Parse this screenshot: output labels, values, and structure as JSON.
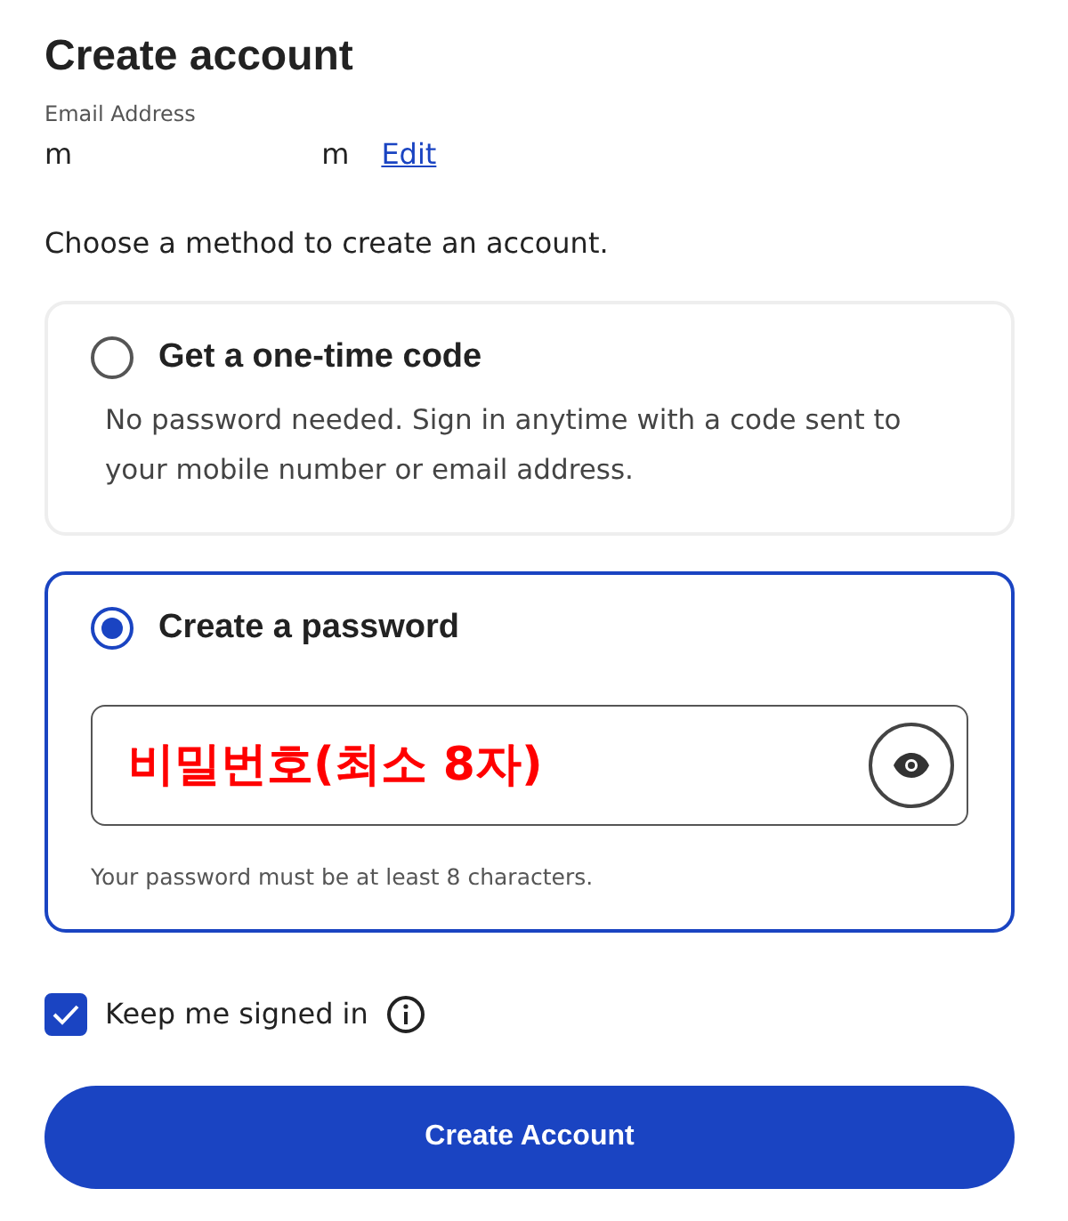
{
  "title": "Create account",
  "email": {
    "label": "Email Address",
    "visible_start": "m",
    "visible_end": "m",
    "edit_link": "Edit"
  },
  "instruction": "Choose a method to create an account.",
  "methods": [
    {
      "kind": "code",
      "label": "Get a one-time code",
      "selected": false,
      "description": "No password needed. Sign in anytime with a code sent to your mobile number or email address."
    },
    {
      "kind": "password",
      "label": "Create a password",
      "selected": true,
      "password_field": {
        "value": "비밀번호(최소 8자)"
      },
      "hint": "Your password must be at least 8 characters."
    }
  ],
  "keep_signed_in": {
    "label": "Keep me signed in",
    "checked": true
  },
  "submit_button": "Create Account"
}
